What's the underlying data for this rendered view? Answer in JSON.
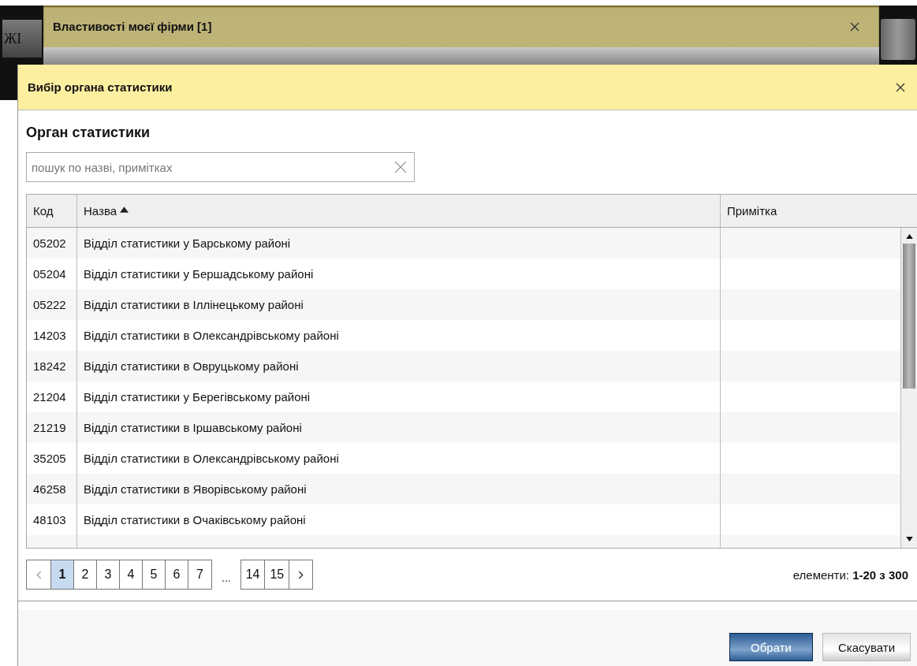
{
  "background_window": {
    "title": "Властивості моєї фірми [1]",
    "side_tab": "ЖІ"
  },
  "dialog": {
    "title": "Вибір органа статистики",
    "section_title": "Орган статистики",
    "search": {
      "placeholder": "пошук по назві, примітках"
    },
    "table": {
      "columns": [
        {
          "label": "Код",
          "sorted": false
        },
        {
          "label": "Назва",
          "sorted": true
        },
        {
          "label": "Примітка",
          "sorted": false
        }
      ],
      "rows": [
        {
          "code": "05202",
          "name": "Відділ статистики у Барському районі"
        },
        {
          "code": "05204",
          "name": "Відділ статистики у Бершадському районі"
        },
        {
          "code": "05222",
          "name": "Відділ статистики в Іллінецькому районі"
        },
        {
          "code": "14203",
          "name": "Відділ статистики в Олександрівському районі"
        },
        {
          "code": "18242",
          "name": "Відділ статистики в Овруцькому районі"
        },
        {
          "code": "21204",
          "name": "Відділ статистики у Берегівському районі"
        },
        {
          "code": "21219",
          "name": "Відділ статистики в Іршавському районі"
        },
        {
          "code": "35205",
          "name": "Відділ статистики в Олександрівському районі"
        },
        {
          "code": "46258",
          "name": "Відділ статистики в Яворівському районі"
        },
        {
          "code": "48103",
          "name": "Відділ статистики в Очаківському районі"
        }
      ]
    },
    "pager": {
      "pages": [
        {
          "kind": "prev",
          "selected": false
        },
        {
          "kind": "page",
          "label": "1",
          "selected": true
        },
        {
          "kind": "page",
          "label": "2",
          "selected": false
        },
        {
          "kind": "page",
          "label": "3",
          "selected": false
        },
        {
          "kind": "page",
          "label": "4",
          "selected": false
        },
        {
          "kind": "page",
          "label": "5",
          "selected": false
        },
        {
          "kind": "page",
          "label": "6",
          "selected": false
        },
        {
          "kind": "page",
          "label": "7",
          "selected": false
        },
        {
          "kind": "gap",
          "label": "..."
        },
        {
          "kind": "page",
          "label": "14",
          "selected": false
        },
        {
          "kind": "page",
          "label": "15",
          "selected": false
        },
        {
          "kind": "next",
          "selected": false
        }
      ],
      "summary": "елементи: **1-20 з 300**"
    },
    "buttons": [
      {
        "label": "Обрати",
        "kind": "primary"
      },
      {
        "label": "Скасувати",
        "kind": "secondary"
      }
    ]
  }
}
